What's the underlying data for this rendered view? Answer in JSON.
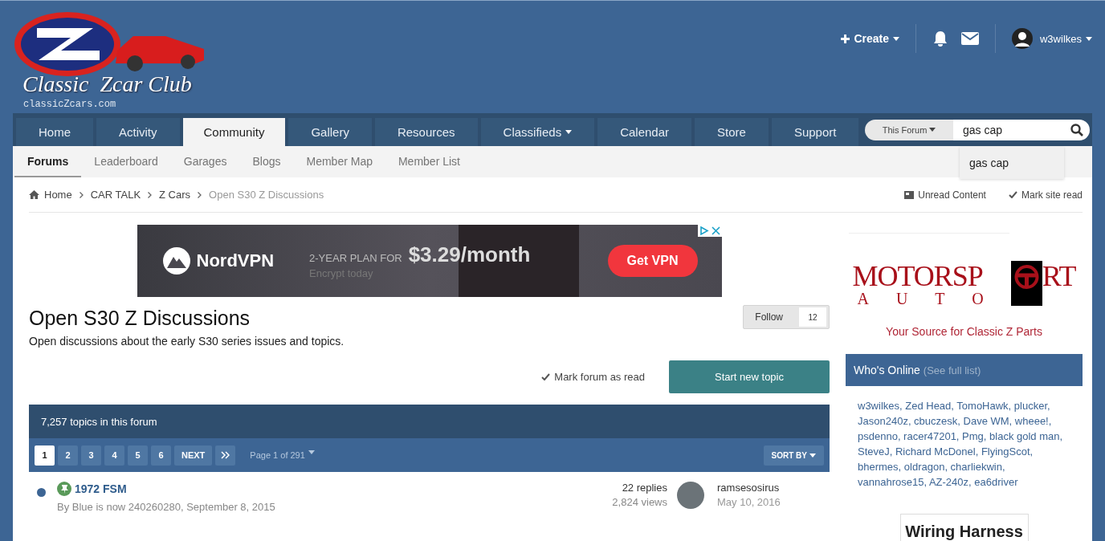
{
  "header": {
    "logo_title": "Classic  Zcar Club",
    "logo_url": "classicZcars.com",
    "create": "Create",
    "username": "w3wilkes"
  },
  "nav": {
    "tabs": [
      {
        "label": "Home",
        "selected": false,
        "dropdown": false
      },
      {
        "label": "Activity",
        "selected": false,
        "dropdown": false
      },
      {
        "label": "Community",
        "selected": true,
        "dropdown": false
      },
      {
        "label": "Gallery",
        "selected": false,
        "dropdown": false
      },
      {
        "label": "Resources",
        "selected": false,
        "dropdown": false
      },
      {
        "label": "Classifieds",
        "selected": false,
        "dropdown": true
      },
      {
        "label": "Calendar",
        "selected": false,
        "dropdown": false
      },
      {
        "label": "Store",
        "selected": false,
        "dropdown": false
      },
      {
        "label": "Support",
        "selected": false,
        "dropdown": false
      }
    ],
    "search": {
      "scope": "This Forum",
      "value": "gas cap",
      "suggestion": "gas cap"
    }
  },
  "subnav": [
    {
      "label": "Forums",
      "selected": true
    },
    {
      "label": "Leaderboard",
      "selected": false
    },
    {
      "label": "Garages",
      "selected": false
    },
    {
      "label": "Blogs",
      "selected": false
    },
    {
      "label": "Member Map",
      "selected": false
    },
    {
      "label": "Member List",
      "selected": false
    }
  ],
  "breadcrumb": [
    {
      "label": "Home",
      "current": false
    },
    {
      "label": "CAR TALK",
      "current": false
    },
    {
      "label": "Z Cars",
      "current": false
    },
    {
      "label": "Open S30 Z Discussions",
      "current": true
    }
  ],
  "page_actions": {
    "unread": "Unread Content",
    "mark_site": "Mark site read"
  },
  "ad": {
    "brand": "NordVPN",
    "plan": "2-YEAR PLAN FOR",
    "price": "$3.29/month",
    "tagline": "Encrypt today",
    "button": "Get VPN"
  },
  "forum": {
    "title": "Open S30 Z Discussions",
    "description": "Open discussions about the early S30 series issues and topics.",
    "follow": "Follow",
    "followers": "12",
    "mark_read": "Mark forum as read",
    "start_topic": "Start new topic"
  },
  "topic_list": {
    "header": "7,257 topics in this forum",
    "pages": [
      {
        "label": "1",
        "selected": true
      },
      {
        "label": "2",
        "selected": false
      },
      {
        "label": "3",
        "selected": false
      },
      {
        "label": "4",
        "selected": false
      },
      {
        "label": "5",
        "selected": false
      },
      {
        "label": "6",
        "selected": false
      }
    ],
    "next": "NEXT",
    "page_info": "Page 1 of 291",
    "sort": "SORT BY",
    "topics": [
      {
        "title": "1972 FSM",
        "pinned": true,
        "unread": true,
        "author_line": "By Blue is now 240260280, September 8, 2015",
        "replies": "22 replies",
        "views": "2,824 views",
        "last_poster": "ramsesosirus",
        "last_date": "May 10, 2016"
      }
    ]
  },
  "sidebar": {
    "sponsor_left": "MOTORSP",
    "sponsor_right": "RT",
    "sponsor_sub": "AUTO",
    "sponsor_tagline": "Your Source for Classic Z Parts",
    "whos_online": {
      "title": "Who's Online",
      "link": "(See full list)",
      "users": "w3wilkes, Zed Head, TomoHawk, plucker, Jason240z, cbuczesk, Dave WM, wheee!, psdenno, racer47201, Pmg, black gold man, SteveJ, Richard McDonel, FlyingScot, bhermes, oldragon, charliekwin, vannahrose15, AZ-240z, ea6driver"
    },
    "ad": "Wiring Harness"
  }
}
